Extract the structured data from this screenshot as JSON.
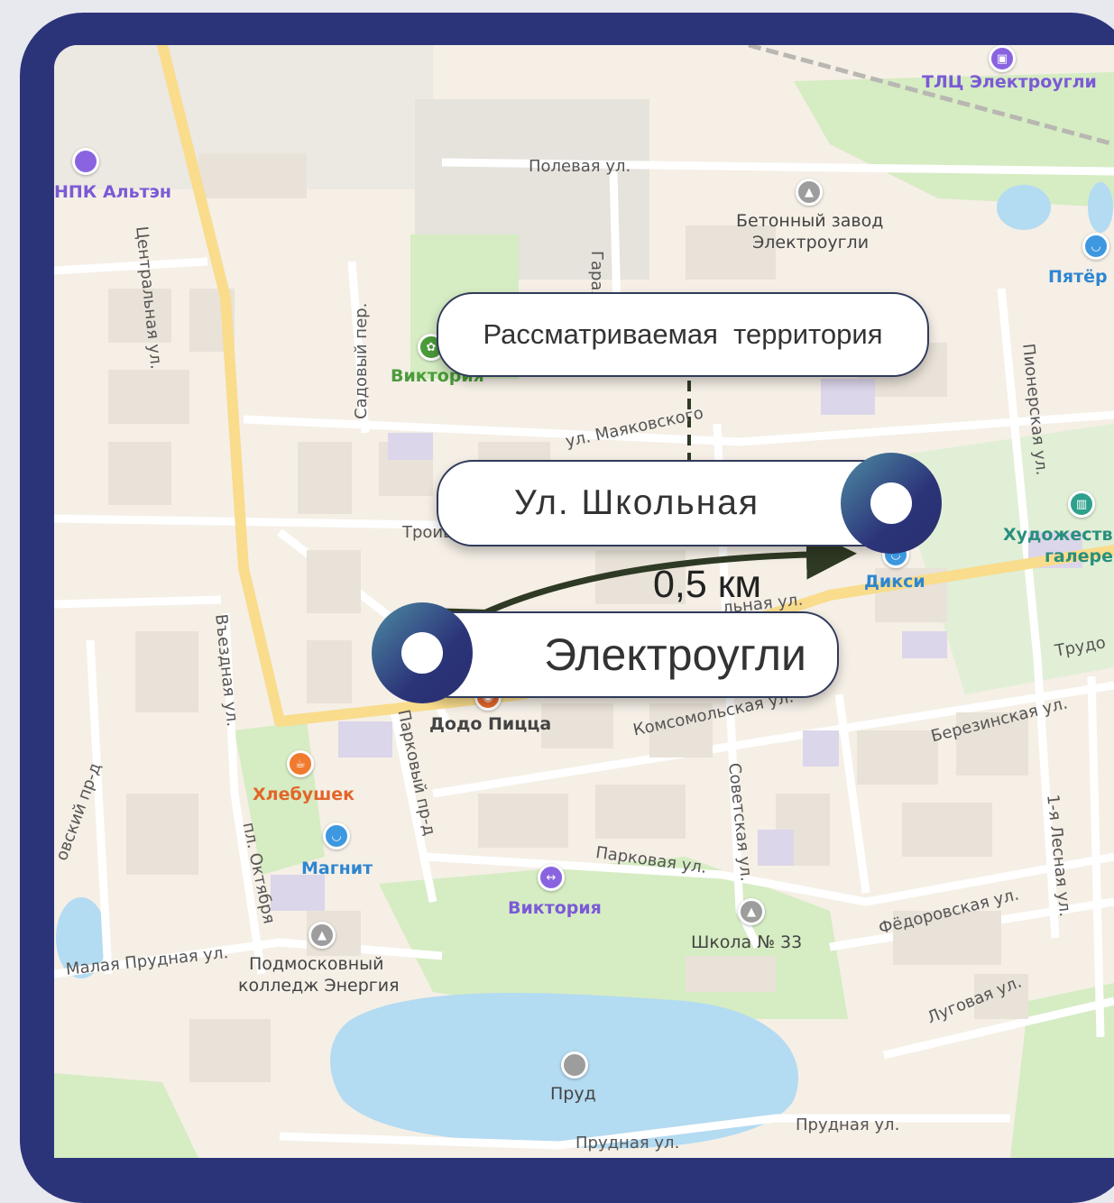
{
  "labels": {
    "focus_area": "Рассматриваемая  территория",
    "street_school": "Ул. Школьная",
    "town": "Электроугли",
    "distance": "0,5 км"
  },
  "streets": {
    "poleva": "Полевая ул.",
    "centralnaya": "Центральная ул.",
    "sadovy": "Садовый пер.",
    "mayakovskogo": "ул. Маяковского",
    "pionerskaya": "Пионерская ул.",
    "troitskaya": "Троиц",
    "vezdnaya": "Въездная ул.",
    "parkovy": "Парковый пр-д",
    "komsomolskaya": "Комсомольская ул.",
    "berezinskaya": "Березинская ул.",
    "parkovaya": "Парковая ул.",
    "sovetskaya": "Советская ул.",
    "lesnaya": "1-я Лесная ул.",
    "fedorovskaya": "Фёдоровская ул.",
    "lugovaya": "Луговая ул.",
    "malaya_prudnaya": "Малая Прудная ул.",
    "ploshad_oktyabrya": "пл. Октября",
    "prudnaya1": "Прудная ул.",
    "prudnaya2": "Прудная ул.",
    "trudovaya": "Трудо",
    "shkolnaya_fragment": "льная ул.",
    "garazh": "Гараж",
    "west_proezd": "овский пр-д"
  },
  "pois": {
    "tlc": "ТЛЦ Электроугли",
    "npk": "НПК Альтэн",
    "beton_1": "Бетонный завод",
    "beton_2": "Электроугли",
    "pyaterochka": "Пятёр",
    "viktoria_1": "Виктория",
    "khud_1": "Художеств",
    "khud_2": "галере",
    "diksi": "Дикси",
    "dodo": "Додо Пицца",
    "hlebushek": "Хлебушек",
    "magnit": "Магнит",
    "viktoria_2": "Виктория",
    "school": "Школа № 33",
    "college_1": "Подмосковный",
    "college_2": "колледж Энергия",
    "prud": "Пруд"
  },
  "colors": {
    "frame": "#2c3479",
    "water": "#b3dbf2",
    "park": "#d6ecc3",
    "main_road": "#f9dc8c",
    "arrow": "#2f3a24"
  },
  "icons": {
    "tlc": "warehouse-icon",
    "npk": "place-icon",
    "beton": "factory-icon",
    "shop": "basket-icon",
    "museum": "gallery-icon",
    "cafe": "cafe-icon",
    "school": "school-icon",
    "pond": "pond-icon"
  }
}
